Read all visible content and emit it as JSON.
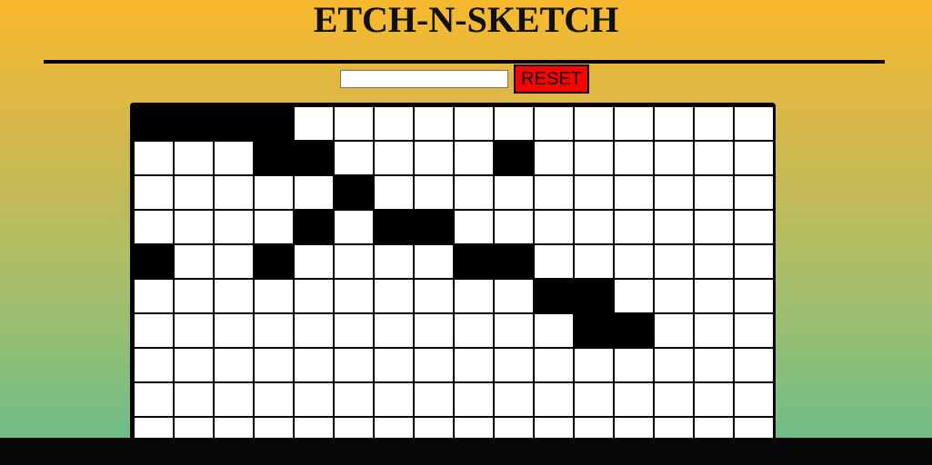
{
  "header": {
    "title": "ETCH-N-SKETCH"
  },
  "controls": {
    "grid_size_value": "",
    "grid_size_placeholder": "",
    "reset_label": "RESET"
  },
  "colors": {
    "background_top": "#f8b92e",
    "background_bottom": "#64bd8e",
    "reset_button": "#ff0000",
    "cell_empty": "#ffffff",
    "cell_filled": "#000000"
  },
  "grid": {
    "columns": 16,
    "visible_rows": 10,
    "filled_cells": [
      [
        0,
        0
      ],
      [
        0,
        1
      ],
      [
        0,
        2
      ],
      [
        0,
        3
      ],
      [
        1,
        3
      ],
      [
        1,
        4
      ],
      [
        1,
        9
      ],
      [
        2,
        5
      ],
      [
        3,
        4
      ],
      [
        3,
        6
      ],
      [
        3,
        7
      ],
      [
        4,
        0
      ],
      [
        4,
        3
      ],
      [
        4,
        8
      ],
      [
        4,
        9
      ],
      [
        5,
        10
      ],
      [
        5,
        11
      ],
      [
        6,
        11
      ],
      [
        6,
        12
      ]
    ]
  }
}
